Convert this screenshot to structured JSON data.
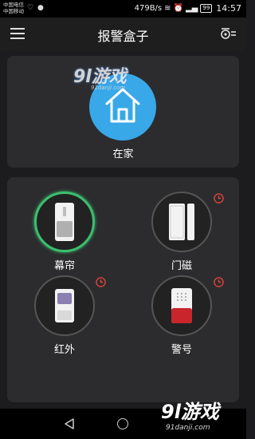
{
  "status_bar": {
    "carrier_1": "中国电信",
    "carrier_2": "中国移动",
    "net_speed": "479B/s",
    "battery": "99",
    "time": "14:57"
  },
  "header": {
    "title": "报警盒子"
  },
  "home": {
    "mode_label": "在家",
    "accent": "#38a8e8"
  },
  "sensors": [
    {
      "label": "幕帘",
      "active": true,
      "timer": false
    },
    {
      "label": "门磁",
      "active": false,
      "timer": true
    },
    {
      "label": "红外",
      "active": false,
      "timer": true
    },
    {
      "label": "警号",
      "active": false,
      "timer": true
    }
  ],
  "watermark": {
    "logo": "9l游戏",
    "url": "91danji.com"
  },
  "colors": {
    "active_ring": "#3bbf6e",
    "timer_icon": "#e0453a"
  }
}
